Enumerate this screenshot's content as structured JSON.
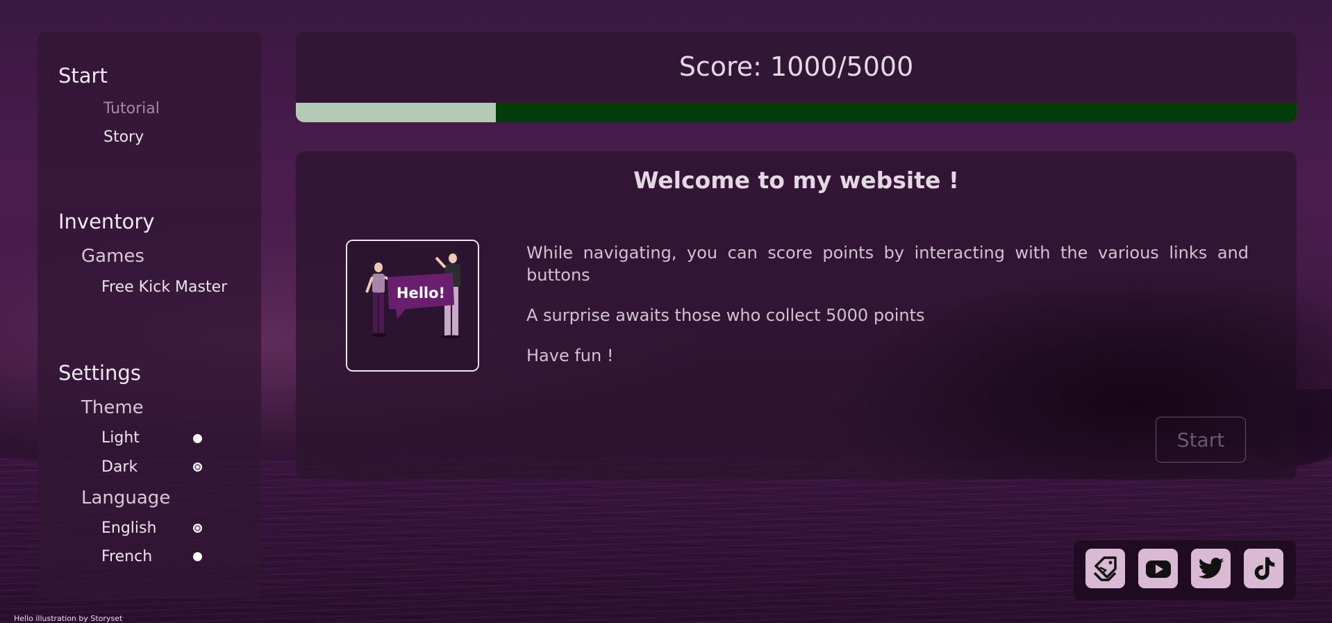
{
  "sidebar": {
    "start": {
      "title": "Start",
      "items": [
        "Tutorial",
        "Story"
      ]
    },
    "inventory": {
      "title": "Inventory",
      "games_title": "Games",
      "games": [
        "Free Kick Master"
      ]
    },
    "settings": {
      "title": "Settings",
      "theme_title": "Theme",
      "theme_options": [
        {
          "label": "Light",
          "selected": false
        },
        {
          "label": "Dark",
          "selected": true
        }
      ],
      "language_title": "Language",
      "language_options": [
        {
          "label": "English",
          "selected": true
        },
        {
          "label": "French",
          "selected": false
        }
      ]
    }
  },
  "score": {
    "label": "Score: 1000/5000",
    "current": 1000,
    "max": 5000,
    "progress_fraction": 0.2,
    "fill_color": "#b3cbb5",
    "track_color": "#003d0a"
  },
  "main": {
    "title": "Welcome to my website !",
    "illustration_text": "Hello!",
    "paragraphs": [
      "While navigating, you can score points by interacting with the various links and buttons",
      "A surprise awaits those who collect 5000 points",
      "Have fun !"
    ],
    "start_button": "Start"
  },
  "social": {
    "icons": [
      "tag-icon",
      "youtube-icon",
      "twitter-icon",
      "tiktok-icon"
    ],
    "icon_bg": "#d9b9d3"
  },
  "footer": {
    "credit": "Hello illustration by Storyset"
  }
}
